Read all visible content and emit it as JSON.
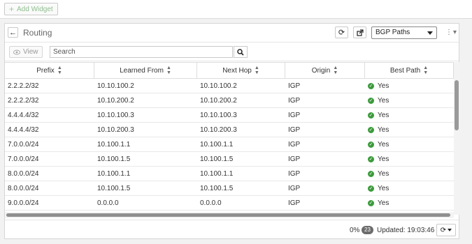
{
  "topbar": {
    "add_widget_label": "Add Widget"
  },
  "widget": {
    "title": "Routing",
    "select_value": "BGP Paths",
    "view_label": "View",
    "search_placeholder": "Search",
    "columns": [
      "Prefix",
      "Learned From",
      "Next Hop",
      "Origin",
      "Best Path"
    ],
    "rows": [
      {
        "prefix": "2.2.2.2/32",
        "learned_from": "10.10.100.2",
        "next_hop": "10.10.100.2",
        "origin": "IGP",
        "best_path": "Yes"
      },
      {
        "prefix": "2.2.2.2/32",
        "learned_from": "10.10.200.2",
        "next_hop": "10.10.200.2",
        "origin": "IGP",
        "best_path": "Yes"
      },
      {
        "prefix": "4.4.4.4/32",
        "learned_from": "10.10.100.3",
        "next_hop": "10.10.100.3",
        "origin": "IGP",
        "best_path": "Yes"
      },
      {
        "prefix": "4.4.4.4/32",
        "learned_from": "10.10.200.3",
        "next_hop": "10.10.200.3",
        "origin": "IGP",
        "best_path": "Yes"
      },
      {
        "prefix": "7.0.0.0/24",
        "learned_from": "10.100.1.1",
        "next_hop": "10.100.1.1",
        "origin": "IGP",
        "best_path": "Yes"
      },
      {
        "prefix": "7.0.0.0/24",
        "learned_from": "10.100.1.5",
        "next_hop": "10.100.1.5",
        "origin": "IGP",
        "best_path": "Yes"
      },
      {
        "prefix": "8.0.0.0/24",
        "learned_from": "10.100.1.1",
        "next_hop": "10.100.1.1",
        "origin": "IGP",
        "best_path": "Yes"
      },
      {
        "prefix": "8.0.0.0/24",
        "learned_from": "10.100.1.5",
        "next_hop": "10.100.1.5",
        "origin": "IGP",
        "best_path": "Yes"
      },
      {
        "prefix": "9.0.0.0/24",
        "learned_from": "0.0.0.0",
        "next_hop": "0.0.0.0",
        "origin": "IGP",
        "best_path": "Yes"
      }
    ],
    "footer": {
      "percent": "0%",
      "count": "23",
      "updated": "Updated: 19:03:46"
    }
  },
  "icons": {
    "add": "plus-icon",
    "back": "arrow-left-icon",
    "refresh": "refresh-icon",
    "external": "external-link-icon",
    "menu": "kebab-icon",
    "view": "eye-icon",
    "search": "search-icon",
    "sort": "sort-icon",
    "best": "check-circle-icon"
  },
  "colors": {
    "check_green": "#3c9a3c",
    "add_widget_green": "#8fbf8f"
  }
}
